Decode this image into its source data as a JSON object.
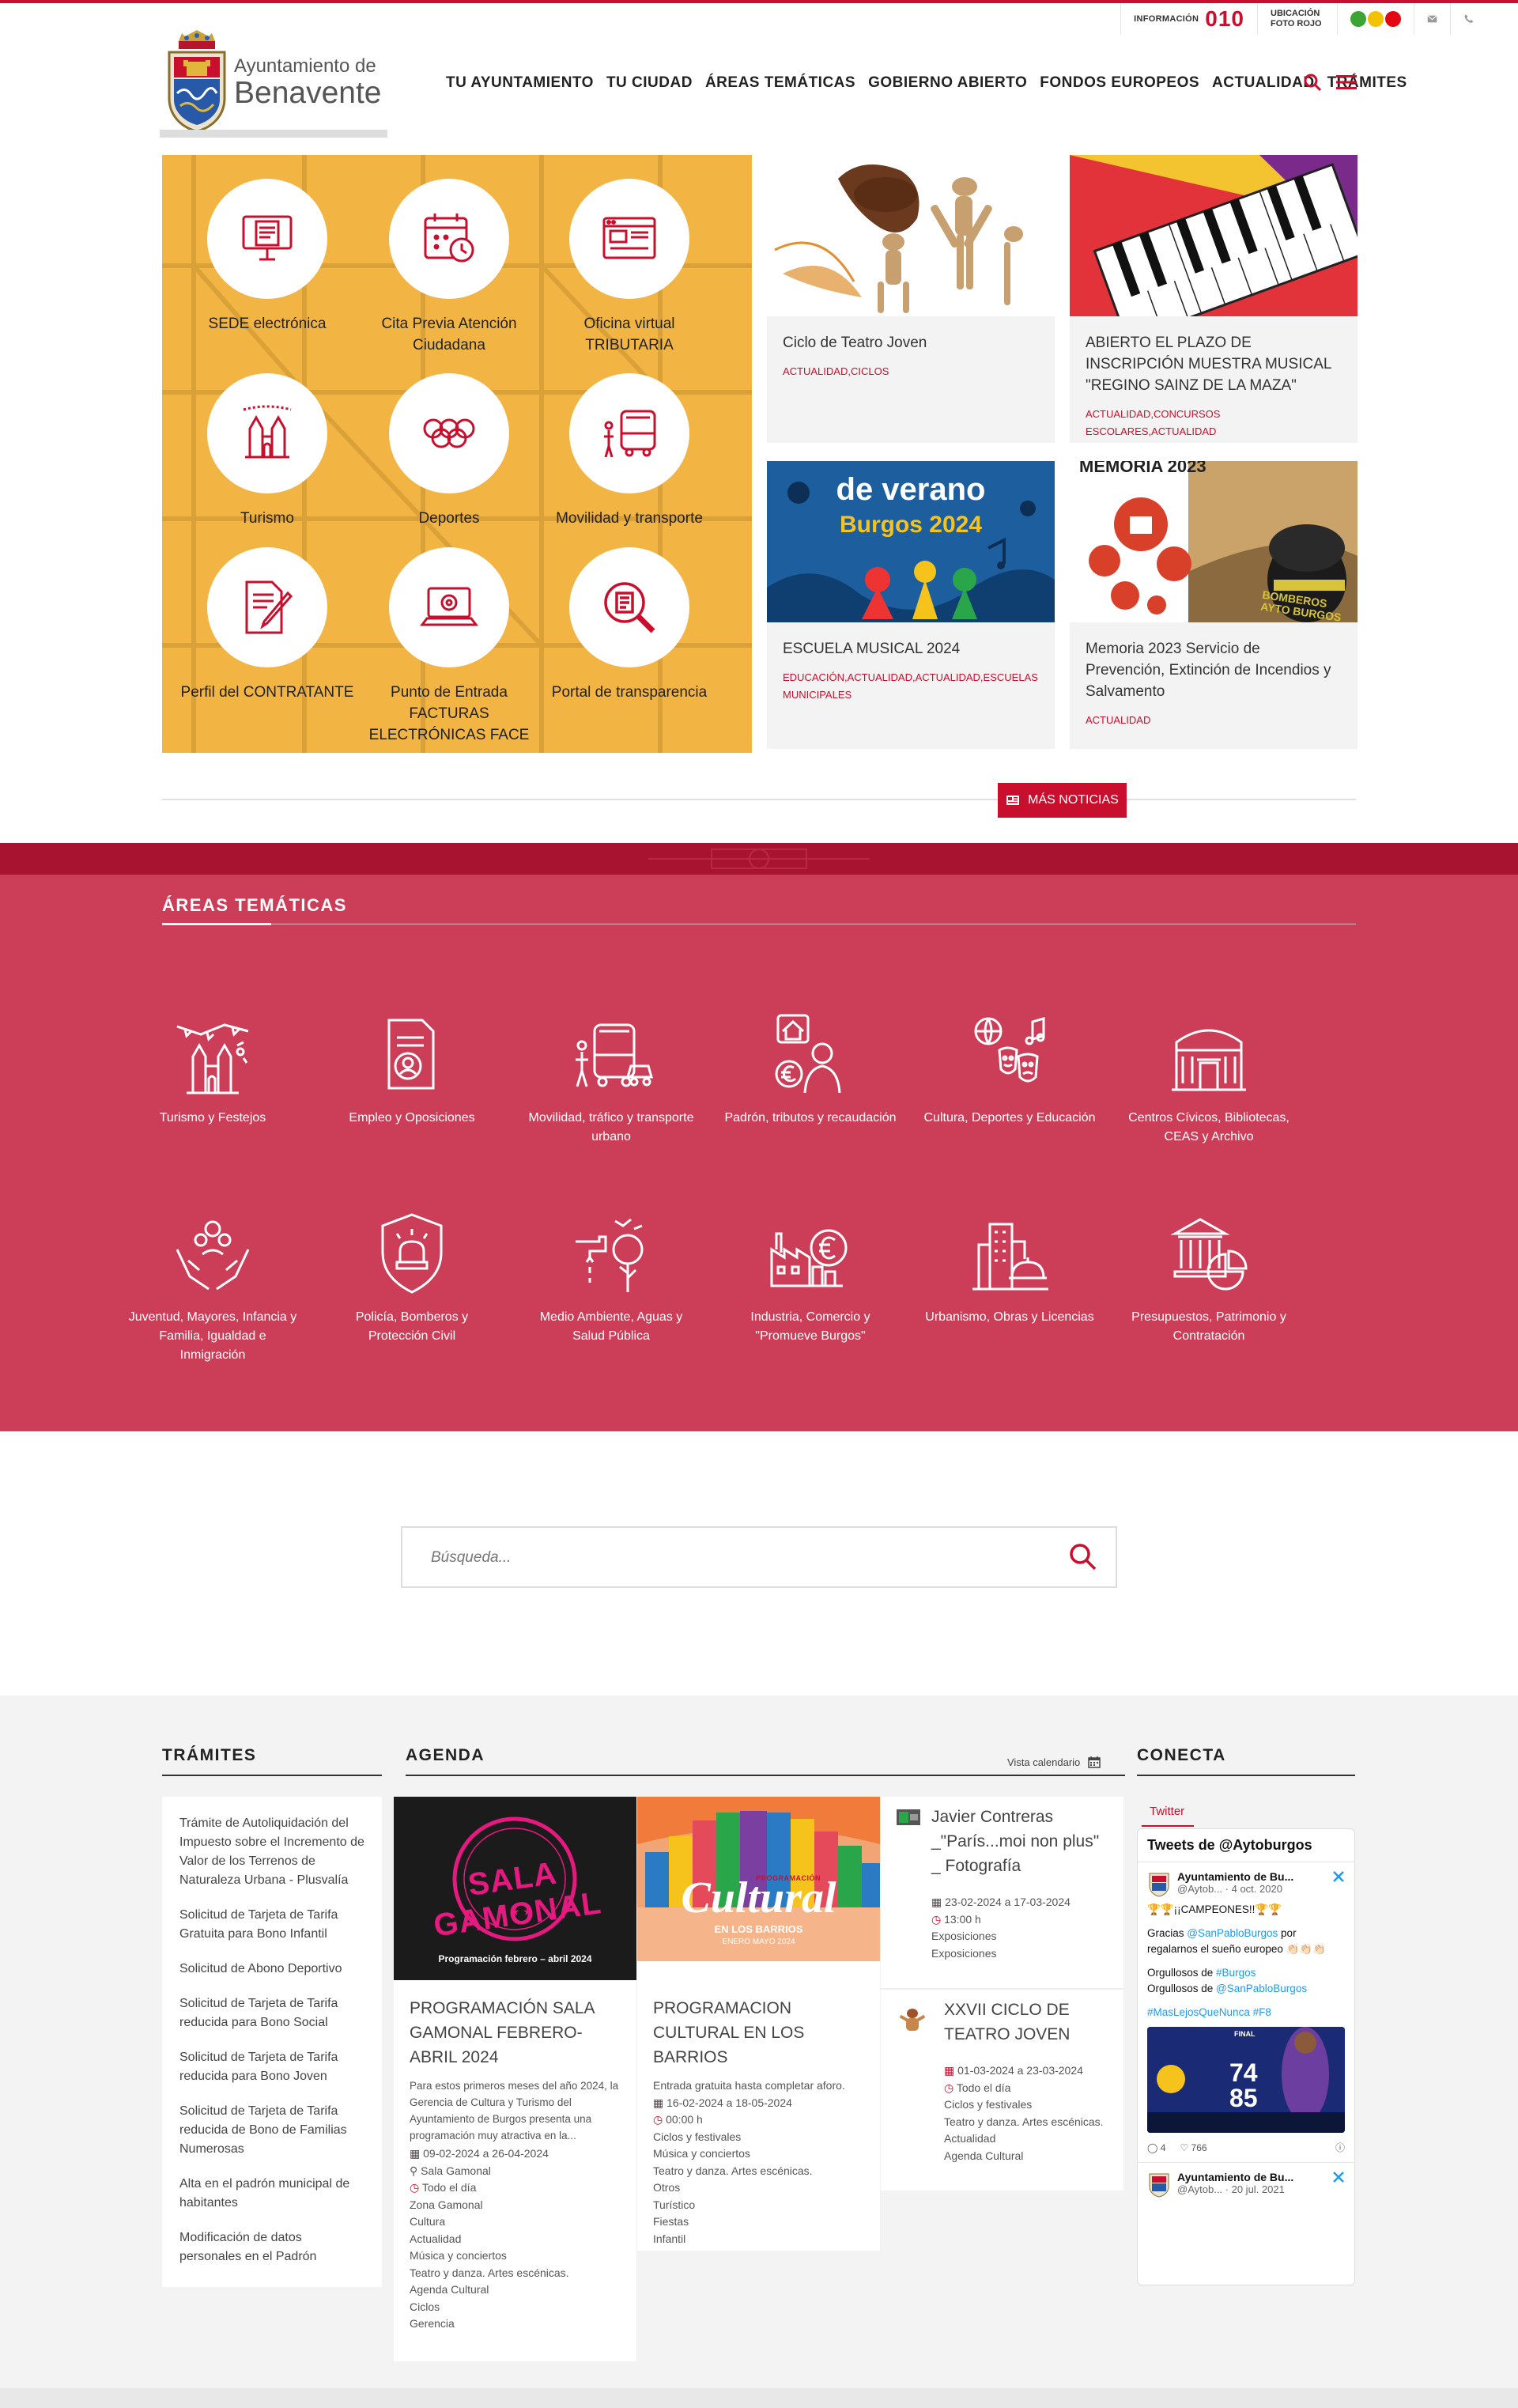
{
  "utility": {
    "info_label": "INFORMACIÓN",
    "info_number": "010",
    "foto_label": "UBICACIÓN FOTO ROJO",
    "dots": [
      "#3aa535",
      "#f2c200",
      "#e30613"
    ]
  },
  "header": {
    "logo_line1": "Ayuntamiento de",
    "logo_line2": "Benavente",
    "nav": [
      "TU AYUNTAMIENTO",
      "TU CIUDAD",
      "ÁREAS TEMÁTICAS",
      "GOBIERNO ABIERTO",
      "FONDOS EUROPEOS",
      "ACTUALIDAD",
      "TRÁMITES"
    ]
  },
  "quick_access": [
    {
      "label": "SEDE electrónica",
      "icon": "monitor-document-icon"
    },
    {
      "label": "Cita Previa Atención Ciudadana",
      "icon": "calendar-clock-icon"
    },
    {
      "label": "Oficina virtual TRIBUTARIA",
      "icon": "browser-window-icon"
    },
    {
      "label": "Turismo",
      "icon": "cathedral-icon"
    },
    {
      "label": "Deportes",
      "icon": "olympic-rings-icon"
    },
    {
      "label": "Movilidad y transporte",
      "icon": "bus-icon"
    },
    {
      "label": "Perfil del CONTRATANTE",
      "icon": "contract-pen-icon"
    },
    {
      "label": "Punto de Entrada FACTURAS ELECTRÓNICAS FACE",
      "icon": "laptop-at-icon"
    },
    {
      "label": "Portal de transparencia",
      "icon": "magnifier-document-icon"
    }
  ],
  "news": [
    {
      "title": "Ciclo de Teatro Joven",
      "cats": "ACTUALIDAD,CICLOS"
    },
    {
      "title": "ABIERTO EL PLAZO DE INSCRIPCIÓN MUESTRA MUSICAL \"REGINO SAINZ DE LA MAZA\"",
      "cats": "ACTUALIDAD,CONCURSOS ESCOLARES,ACTUALIDAD"
    },
    {
      "title": "ESCUELA MUSICAL 2024",
      "cats": "EDUCACIÓN,ACTUALIDAD,ACTUALIDAD,ESCUELAS MUNICIPALES",
      "img_line1": "de verano",
      "img_line2": "Burgos 2024"
    },
    {
      "title": "Memoria 2023 Servicio de Prevención, Extinción de Incendios y Salvamento",
      "cats": "ACTUALIDAD",
      "img_line1": "MEMORIA 2023",
      "img_line2": "BOMBEROS AYTO BURGOS"
    }
  ],
  "more_news": "MÁS NOTICIAS",
  "areas": {
    "title": "ÁREAS TEMÁTICAS",
    "items": [
      {
        "label": "Turismo y Festejos",
        "icon": "cathedral-festival-icon"
      },
      {
        "label": "Empleo y Oposiciones",
        "icon": "document-person-icon"
      },
      {
        "label": "Movilidad, tráfico y transporte urbano",
        "icon": "bus-car-icon"
      },
      {
        "label": "Padrón, tributos y recaudación",
        "icon": "house-euro-person-icon"
      },
      {
        "label": "Cultura, Deportes y Educación",
        "icon": "masks-ball-music-icon"
      },
      {
        "label": "Centros Cívicos, Bibliotecas, CEAS y Archivo",
        "icon": "building-icon"
      },
      {
        "label": "Juventud, Mayores, Infancia y Familia, Igualdad e Inmigración",
        "icon": "hands-people-icon"
      },
      {
        "label": "Policía, Bomberos y Protección Civil",
        "icon": "shield-siren-icon"
      },
      {
        "label": "Medio Ambiente, Aguas y Salud Pública",
        "icon": "tap-tree-icon"
      },
      {
        "label": "Industria, Comercio y \"Promueve Burgos\"",
        "icon": "factory-euro-icon"
      },
      {
        "label": "Urbanismo, Obras y Licencias",
        "icon": "buildings-helmet-icon"
      },
      {
        "label": "Presupuestos, Patrimonio y Contratación",
        "icon": "institution-chart-icon"
      }
    ]
  },
  "search": {
    "placeholder": "Búsqueda..."
  },
  "tramites": {
    "title": "TRÁMITES",
    "items": [
      "Trámite de Autoliquidación del Impuesto sobre el Incremento de Valor de los Terrenos de Naturaleza Urbana - Plusvalía",
      "Solicitud de Tarjeta de Tarifa Gratuita para Bono Infantil",
      "Solicitud de Abono Deportivo",
      "Solicitud de Tarjeta de Tarifa reducida para Bono Social",
      "Solicitud de Tarjeta de Tarifa reducida para Bono Joven",
      "Solicitud de Tarjeta de Tarifa reducida de Bono de Familias Numerosas",
      "Alta en el padrón municipal de habitantes",
      "Modificación de datos personales en el Padrón"
    ]
  },
  "agenda": {
    "title": "AGENDA",
    "calendar_link": "Vista calendario",
    "items": [
      {
        "img_title": "SALA GAMONAL",
        "img_sub": "Programación febrero – abril 2024",
        "title": "PROGRAMACIÓN SALA GAMONAL FEBRERO-ABRIL 2024",
        "desc": "Para estos primeros meses del año 2024, la Gerencia de Cultura y Turismo del Ayuntamiento de Burgos presenta una programación muy atractiva en la...",
        "dates": "09-02-2024 a 26-04-2024",
        "place": "Sala Gamonal",
        "time": "Todo el día",
        "tags": [
          "Zona Gamonal",
          "Cultura",
          "Actualidad",
          "Música y conciertos",
          "Teatro y danza. Artes escénicas.",
          "Agenda Cultural",
          "Ciclos",
          "Gerencia"
        ]
      },
      {
        "img_title": "Cultural",
        "img_sub": "EN LOS BARRIOS",
        "img_top": "PROGRAMACIÓN",
        "img_date": "ENERO MAYO 2024",
        "title": "PROGRAMACION CULTURAL EN LOS BARRIOS",
        "desc": "Entrada gratuita hasta completar aforo.",
        "dates": "16-02-2024 a 18-05-2024",
        "time": "00:00  h",
        "tags": [
          "Ciclos y festivales",
          "Música y conciertos",
          "Teatro y danza. Artes escénicas.",
          "Otros",
          "Turístico",
          "Fiestas",
          "Infantil"
        ]
      },
      {
        "title": "Javier Contreras _\"París...moi non plus\" _ Fotografía",
        "dates": "23-02-2024 a 17-03-2024",
        "time": "13:00  h",
        "tags": [
          "Exposiciones",
          "Exposiciones"
        ]
      },
      {
        "title": "XXVII CICLO DE TEATRO JOVEN",
        "dates": "01-03-2024 a 23-03-2024",
        "time": "Todo el día",
        "tags": [
          "Ciclos y festivales",
          "Teatro y danza. Artes escénicas.",
          "Actualidad",
          "Agenda Cultural"
        ]
      }
    ]
  },
  "conecta": {
    "title": "CONECTA",
    "tab": "Twitter",
    "feed_title": "Tweets de @Aytoburgos",
    "tweets": [
      {
        "name": "Ayuntamiento de Bu...",
        "handle": "@Aytob...",
        "date": "· 4 oct. 2020",
        "l1": "🏆🏆¡¡CAMPEONES!!🏆🏆",
        "l2": "Gracias ",
        "mention1": "@SanPabloBurgos",
        "l2b": " por regalarnos el sueño europeo 👏🏻👏🏻👏🏻",
        "l3": "Orgullosos de ",
        "mention2": "#Burgos",
        "l4": "Orgullosos de ",
        "mention3": "@SanPabloBurgos",
        "tags": "#MasLejosQueNunca #F8",
        "replies": "4",
        "likes": "766",
        "score1": "74",
        "score2": "85",
        "img_word": "FINAL"
      },
      {
        "name": "Ayuntamiento de Bu...",
        "handle": "@Aytob...",
        "date": "· 20 jul. 2021"
      }
    ]
  }
}
